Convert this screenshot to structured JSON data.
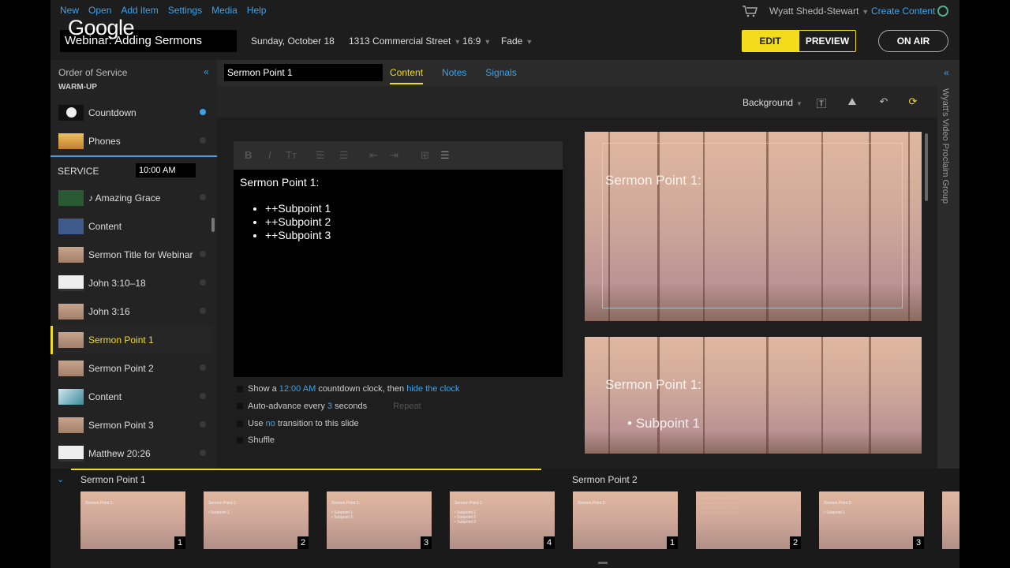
{
  "menu": [
    "New",
    "Open",
    "Add item",
    "Settings",
    "Media",
    "Help"
  ],
  "logo": "Google",
  "presentation_title": "Webinar: Adding Sermons",
  "meta": {
    "date": "Sunday, October 18",
    "location": "1313 Commercial Street",
    "aspect": "16:9",
    "transition": "Fade"
  },
  "user": {
    "name": "Wyatt Shedd-Stewart",
    "create": "Create Content"
  },
  "mode": {
    "edit": "EDIT",
    "preview": "PREVIEW",
    "on_air": "ON AIR"
  },
  "sidebar": {
    "title": "Order of Service",
    "warmup_label": "WARM-UP",
    "service_label": "SERVICE",
    "service_time": "10:00 AM",
    "items": [
      {
        "label": "Countdown",
        "thumb": "play"
      },
      {
        "label": "Phones",
        "thumb": "gold"
      },
      {
        "label": "♪ Amazing Grace",
        "thumb": "grn"
      },
      {
        "label": "Content",
        "thumb": "blu"
      },
      {
        "label": "Sermon Title for Webinar",
        "thumb": "forest"
      },
      {
        "label": "John 3:10–18",
        "thumb": "wht"
      },
      {
        "label": "John 3:16",
        "thumb": "forest"
      },
      {
        "label": "Sermon Point 1",
        "thumb": "forest",
        "active": true
      },
      {
        "label": "Sermon Point 2",
        "thumb": "forest"
      },
      {
        "label": "Content",
        "thumb": "sky"
      },
      {
        "label": "Sermon  Point 3",
        "thumb": "forest"
      },
      {
        "label": "Matthew 20:26",
        "thumb": "wht"
      }
    ]
  },
  "editor": {
    "slide_name": "Sermon Point 1",
    "tabs": [
      "Content",
      "Notes",
      "Signals"
    ],
    "background_label": "Background",
    "text_heading": "Sermon Point 1:",
    "bullets": [
      "++Subpoint 1",
      "++Subpoint 2",
      "++Subpoint 3"
    ],
    "options": {
      "countdown_pre": "Show a",
      "countdown_time": "12:00 AM",
      "countdown_mid": "countdown clock, then",
      "countdown_action": "hide the clock",
      "auto_pre": "Auto-advance every",
      "auto_count": "3",
      "auto_post": "seconds",
      "repeat": "Repeat",
      "use_pre": "Use",
      "use_val": "no",
      "use_post": "transition to this slide",
      "shuffle": "Shuffle"
    }
  },
  "preview": {
    "slide1_title": "Sermon Point 1:",
    "slide2_title": "Sermon Point 1:",
    "slide2_bullet": "Subpoint 1"
  },
  "rightbar": {
    "label": "Wyatt's Video Proclaim Group"
  },
  "filmstrip": {
    "group1": "Sermon Point 1",
    "group2": "Sermon Point 2",
    "thumbs": [
      {
        "num": "1"
      },
      {
        "num": "2"
      },
      {
        "num": "3"
      },
      {
        "num": "4"
      },
      {
        "num": "1"
      },
      {
        "num": "2"
      },
      {
        "num": "3"
      }
    ]
  },
  "colors": {
    "accent": "#f2dc1b",
    "link": "#3da3e8"
  }
}
